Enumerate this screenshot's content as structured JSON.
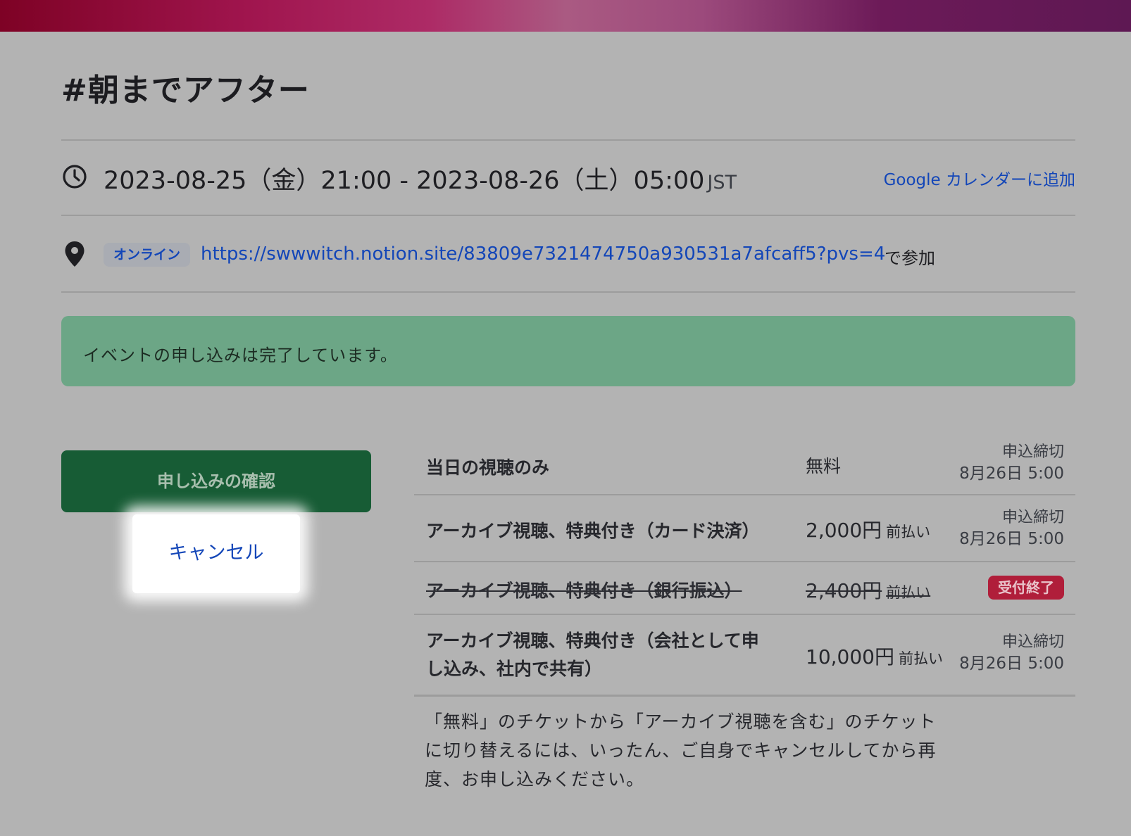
{
  "event": {
    "title": "#朝までアフター",
    "datetime": "2023-08-25（金）21:00 - 2023-08-26（土）05:00",
    "timezone": "JST",
    "calendar_link": "Google カレンダーに追加",
    "location_badge": "オンライン",
    "location_url": "https://swwwitch.notion.site/83809e7321474750a930531a7afcaff5?pvs=4",
    "location_suffix": "で参加"
  },
  "notice": {
    "text": "イベントの申し込みは完了しています。",
    "color": "#6ca686"
  },
  "actions": {
    "confirm_label": "申し込みの確認",
    "cancel_label": "キャンセル"
  },
  "tickets": [
    {
      "name": "当日の視聴のみ",
      "price": "無料",
      "payment": "",
      "deadline_label": "申込締切",
      "deadline_date": "8月26日 5:00",
      "status": "open"
    },
    {
      "name": "アーカイブ視聴、特典付き（カード決済）",
      "price": "2,000円",
      "payment": "前払い",
      "deadline_label": "申込締切",
      "deadline_date": "8月26日 5:00",
      "status": "open"
    },
    {
      "name": "アーカイブ視聴、特典付き（銀行振込）",
      "price": "2,400円",
      "payment": "前払い",
      "status": "closed",
      "status_label": "受付終了"
    },
    {
      "name_line1": "アーカイブ視聴、特典付き（会社として申",
      "name_line2": "し込み、社内で共有）",
      "price": "10,000円",
      "payment": "前払い",
      "deadline_label": "申込締切",
      "deadline_date": "8月26日 5:00",
      "status": "open"
    }
  ],
  "note": {
    "line1": "「無料」のチケットから「アーカイブ視聴を含む」のチケット",
    "line2": "に切り替えるには、いったん、ご自身でキャンセルしてから再",
    "line3": "度、お申し込みください。"
  },
  "colors": {
    "link": "#1346b8",
    "primary_button": "#175c35",
    "closed_badge": "#b01e3a"
  },
  "icons": {
    "time": "clock-icon",
    "location": "map-pin-icon"
  }
}
